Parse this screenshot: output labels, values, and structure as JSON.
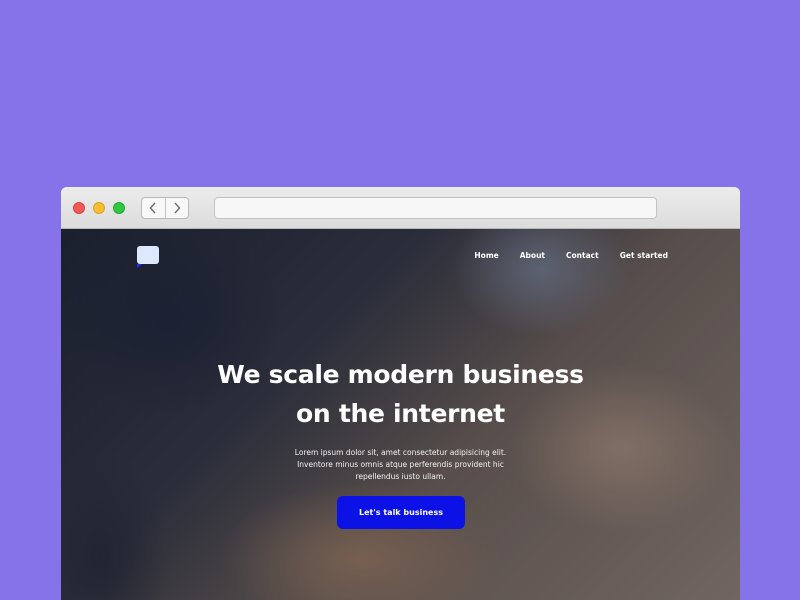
{
  "browser": {
    "address_bar": {
      "value": "",
      "placeholder": ""
    }
  },
  "site": {
    "nav": {
      "items": [
        {
          "label": "Home"
        },
        {
          "label": "About"
        },
        {
          "label": "Contact"
        },
        {
          "label": "Get started"
        }
      ]
    },
    "hero": {
      "title_line1": "We scale modern business",
      "title_line2": "on the internet",
      "subtitle": "Lorem ipsum dolor sit, amet consectetur adipisicing elit. Inventore minus omnis atque perferendis provident hic repellendus iusto ullam.",
      "cta_label": "Let's talk business"
    }
  },
  "icons": [
    "traffic-light-close-icon",
    "traffic-light-minimize-icon",
    "traffic-light-zoom-icon",
    "chevron-left-icon",
    "chevron-right-icon",
    "speech-bubble-logo-icon"
  ],
  "colors": {
    "page_background": "#8673e9",
    "cta_background": "#0c12e6",
    "logo_accent": "#1a33e6"
  }
}
